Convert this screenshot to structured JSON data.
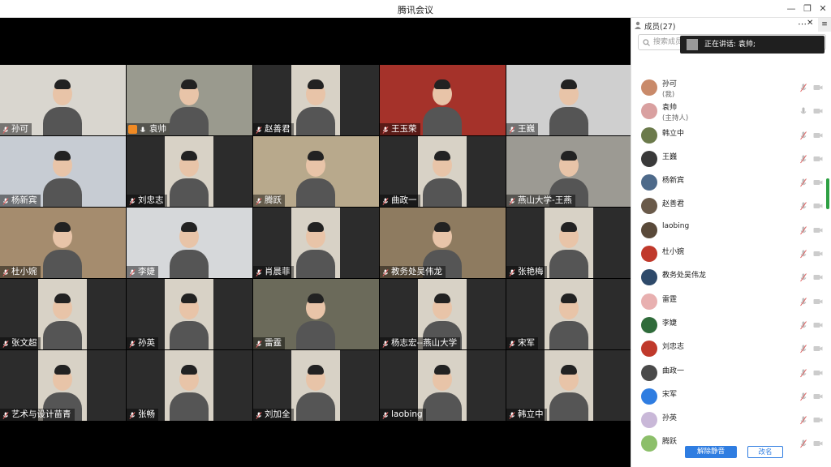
{
  "window": {
    "title": "腾讯会议",
    "minimize": "—",
    "restore": "❐",
    "close": "✕"
  },
  "tiles": [
    {
      "name": "孙可",
      "bg": "#d9d6cf"
    },
    {
      "name": "袁帅",
      "bg": "#9a9a8e",
      "host": true
    },
    {
      "name": "赵善君",
      "bg": "#2c2c2c"
    },
    {
      "name": "王玉荣",
      "bg": "#a5322a"
    },
    {
      "name": "王巍",
      "bg": "#cfcfcf"
    },
    {
      "name": "杨新宾",
      "bg": "#c7ccd3"
    },
    {
      "name": "刘忠志",
      "bg": "#2c2c2c"
    },
    {
      "name": "腾跃",
      "bg": "#b8a98c"
    },
    {
      "name": "曲政一",
      "bg": "#2c2c2c"
    },
    {
      "name": "燕山大学-王燕",
      "bg": "#9c9a93"
    },
    {
      "name": "杜小婉",
      "bg": "#a58c6e"
    },
    {
      "name": "李婕",
      "bg": "#d6d8da"
    },
    {
      "name": "肖晨菲",
      "bg": "#2c2c2c"
    },
    {
      "name": "教务处吴伟龙",
      "bg": "#8e7b60"
    },
    {
      "name": "张艳梅",
      "bg": "#2c2c2c"
    },
    {
      "name": "张文超",
      "bg": "#2c2c2c"
    },
    {
      "name": "孙英",
      "bg": "#2c2c2c"
    },
    {
      "name": "雷霆",
      "bg": "#6b6a5a"
    },
    {
      "name": "杨志宏--燕山大学",
      "bg": "#2c2c2c"
    },
    {
      "name": "宋军",
      "bg": "#2c2c2c"
    },
    {
      "name": "艺术与设计苗青",
      "bg": "#2c2c2c"
    },
    {
      "name": "张畅",
      "bg": "#2c2c2c"
    },
    {
      "name": "刘加全",
      "bg": "#2c2c2c"
    },
    {
      "name": "laobing",
      "bg": "#2c2c2c"
    },
    {
      "name": "韩立中",
      "bg": "#2c2c2c"
    }
  ],
  "sidebar": {
    "title": "成员(27)",
    "search_placeholder": "搜索成员",
    "speaking_label": "正在讲话: 袁帅;",
    "members": [
      {
        "name": "孙可",
        "sub": "(我)",
        "color": "#c98a6a"
      },
      {
        "name": "袁帅",
        "sub": "(主持人)",
        "color": "#d9a0a0"
      },
      {
        "name": "韩立中",
        "sub": "",
        "color": "#6b7a4b"
      },
      {
        "name": "王巍",
        "sub": "",
        "color": "#3a3a3a"
      },
      {
        "name": "杨新宾",
        "sub": "",
        "color": "#4e6a8a"
      },
      {
        "name": "赵善君",
        "sub": "",
        "color": "#6a5a4a"
      },
      {
        "name": "laobing",
        "sub": "",
        "color": "#5a4a3a"
      },
      {
        "name": "杜小婉",
        "sub": "",
        "color": "#c0392b"
      },
      {
        "name": "教务处吴伟龙",
        "sub": "",
        "color": "#2e4a6a"
      },
      {
        "name": "雷霆",
        "sub": "",
        "color": "#e8b0b0"
      },
      {
        "name": "李婕",
        "sub": "",
        "color": "#2f6b3a"
      },
      {
        "name": "刘忠志",
        "sub": "",
        "color": "#c0392b"
      },
      {
        "name": "曲政一",
        "sub": "",
        "color": "#4a4a4a"
      },
      {
        "name": "宋军",
        "sub": "",
        "color": "#2f7de1"
      },
      {
        "name": "孙英",
        "sub": "",
        "color": "#c9b8d8"
      },
      {
        "name": "腾跃",
        "sub": "",
        "color": "#8cbf6a"
      }
    ],
    "unmute_all": "解除静音",
    "rename": "改名"
  },
  "colors": {
    "accent": "#2f7de1",
    "muted_red": "#e06060"
  }
}
